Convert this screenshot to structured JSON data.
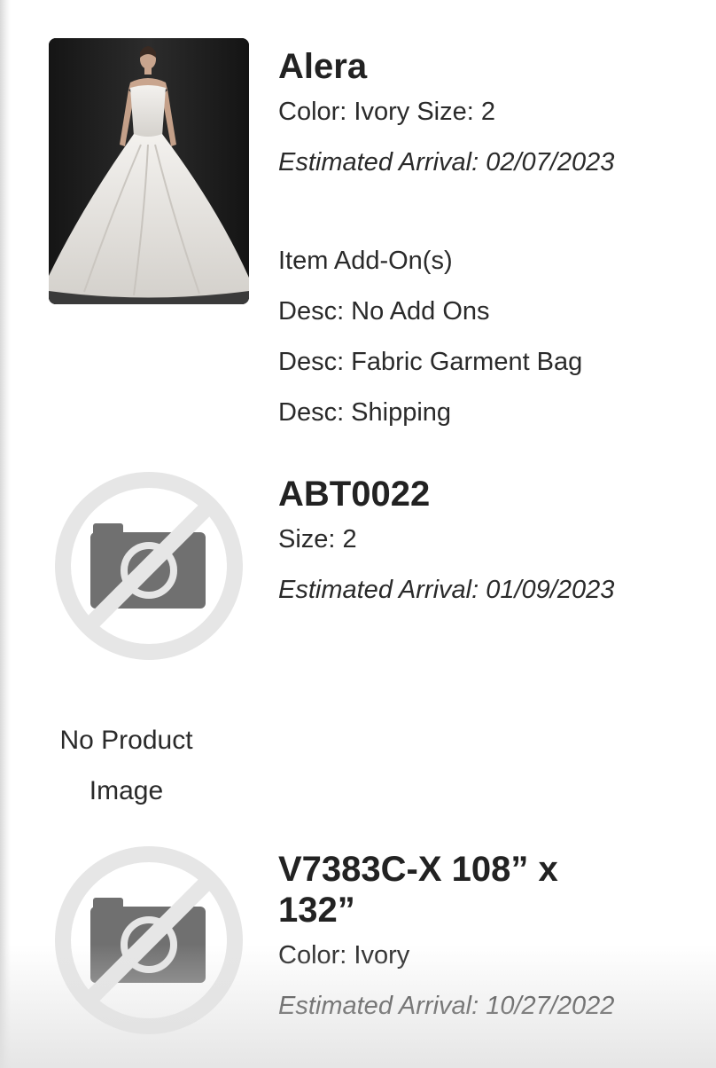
{
  "items": [
    {
      "name": "Alera",
      "detail": "Color: Ivory Size: 2",
      "arrival": "Estimated Arrival: 02/07/2023",
      "addons_heading": "Item Add-On(s)",
      "addons": [
        "Desc: No Add Ons",
        "Desc: Fabric Garment Bag",
        "Desc: Shipping"
      ],
      "image": "wedding-gown-photo"
    },
    {
      "name": "ABT0022",
      "detail": "Size: 2",
      "arrival": "Estimated Arrival: 01/09/2023",
      "image": "no-image-icon",
      "no_image_label": [
        "No Product",
        "Image"
      ]
    },
    {
      "name_line1": "V7383C-X 108” x",
      "name_line2": "132”",
      "detail": "Color: Ivory",
      "arrival": "Estimated Arrival: 10/27/2022",
      "image": "no-image-icon"
    }
  ],
  "colors": {
    "text": "#2a2a2a",
    "placeholder_ring": "#e6e6e6",
    "placeholder_camera": "#707070"
  }
}
